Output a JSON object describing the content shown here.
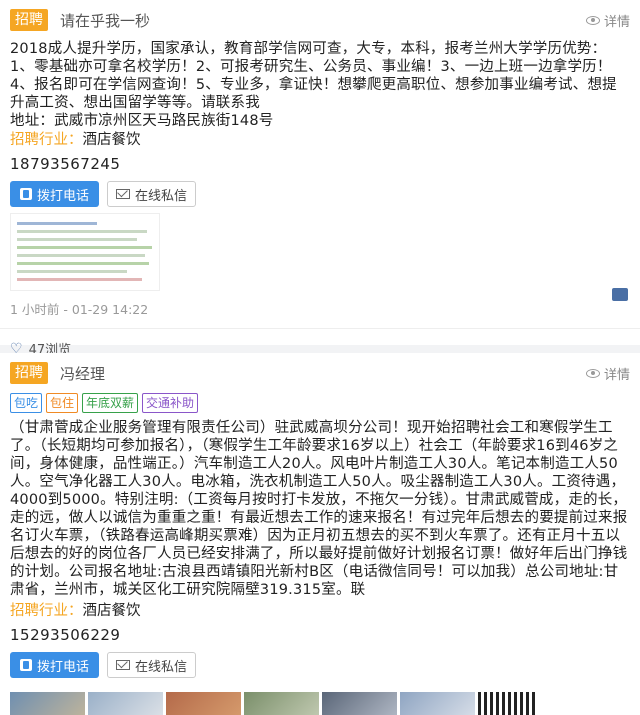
{
  "post1": {
    "tag": "招聘",
    "poster": "请在乎我一秒",
    "detail_label": "详情",
    "body": "2018成人提升学历，国家承认，教育部学信网可查，大专，本科，报考兰州大学学历优势：1、零基础亦可拿名校学历！2、可报考研究生、公务员、事业编！3、一边上班一边拿学历！4、报名即可在学信网查询！5、专业多，拿证快！想攀爬更高职位、想参加事业编考试、想提升高工资、想出国留学等等。请联系我",
    "address": "地址：武威市凉州区天马路民族街148号",
    "industry_key": "招聘行业：",
    "industry_val": "酒店餐饮",
    "phone": "18793567245",
    "call_label": "拨打电话",
    "msg_label": "在线私信",
    "time": "1 小时前 - 01-29 14:22",
    "views": "47浏览"
  },
  "post2": {
    "tag": "招聘",
    "poster": "冯经理",
    "detail_label": "详情",
    "chips": [
      "包吃",
      "包住",
      "年底双薪",
      "交通补助"
    ],
    "body": "（甘肃菅成企业服务管理有限责任公司）驻武威高坝分公司！现开始招聘社会工和寒假学生工了。（长短期均可参加报名），（寒假学生工年龄要求16岁以上）社会工（年龄要求16到46岁之间，身体健康，品性端正。）汽车制造工人20人。风电叶片制造工人30人。笔记本制造工人50人。空气净化器工人30人。电冰箱，洗衣机制造工人50人。吸尘器制造工人30人。工资待遇，4000到5000。特别注明:（工资每月按时打卡发放，不拖欠一分钱）。甘肃武威菅成，走的长，走的远，做人以诚信为重重之重！有最近想去工作的速来报名！有过完年后想去的要提前过来报名订火车票，（铁路春运高峰期买票难）因为正月初五想去的买不到火车票了。还有正月十五以后想去的好的岗位各厂人员已经安排满了，所以最好提前做好计划报名订票！做好年后出门挣钱的计划。公司报名地址:古浪县西靖镇阳光新村B区（电话微信同号！可以加我）总公司地址:甘肃省，兰州市，城关区化工研究院隔壁319.315室。联",
    "industry_key": "招聘行业：",
    "industry_val": "酒店餐饮",
    "phone": "15293506229",
    "call_label": "拨打电话",
    "msg_label": "在线私信"
  },
  "colors": {
    "tag": "#f5a623",
    "call_button": "#3a8fe6",
    "accent_blue": "#4a6fa5"
  }
}
